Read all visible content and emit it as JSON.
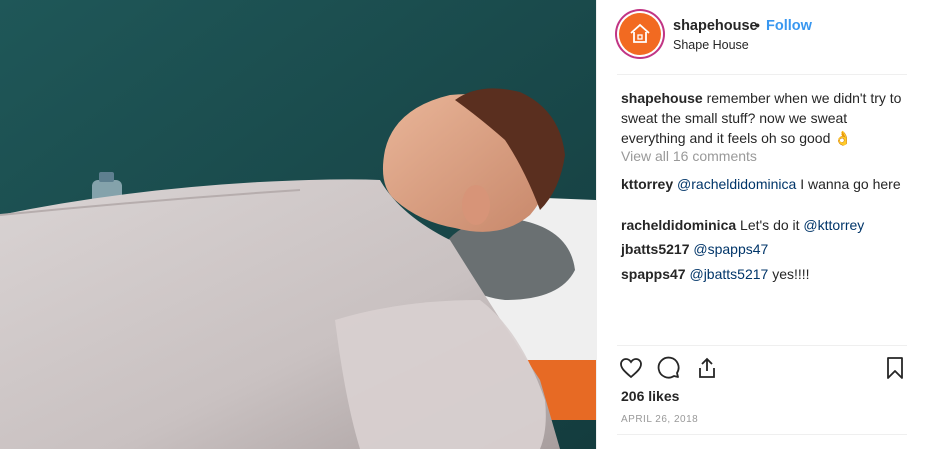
{
  "post": {
    "image_alt": "Man lying under a grey blanket with a towel under his head",
    "header": {
      "username": "shapehouse",
      "separator": "•",
      "follow_label": "Follow",
      "subtitle": "Shape House",
      "avatar_icon": "house-logo-icon",
      "avatar_color": "#f26a21"
    },
    "caption": {
      "username": "shapehouse",
      "text": " remember when we didn't try to sweat the small stuff? now we sweat everything and it feels oh so good 👌"
    },
    "view_all_comments": "View all 16 comments",
    "comments": [
      {
        "username": "kttorrey",
        "mention": "@racheldidominica",
        "text": " I wanna go here"
      },
      {
        "username": "racheldidominica",
        "text": " Let's do it ",
        "mention": "@kttorrey"
      },
      {
        "username": "jbatts5217",
        "mention": "@spapps47",
        "text": ""
      },
      {
        "username": "spapps47",
        "mention": "@jbatts5217",
        "text": " yes!!!!"
      }
    ],
    "actions": {
      "like_icon": "heart-icon",
      "comment_icon": "comment-icon",
      "share_icon": "share-icon",
      "save_icon": "bookmark-icon"
    },
    "likes": "206 likes",
    "date": "APRIL 26, 2018",
    "colors": {
      "link": "#3897f0",
      "mention": "#003569",
      "muted": "#999999"
    }
  }
}
